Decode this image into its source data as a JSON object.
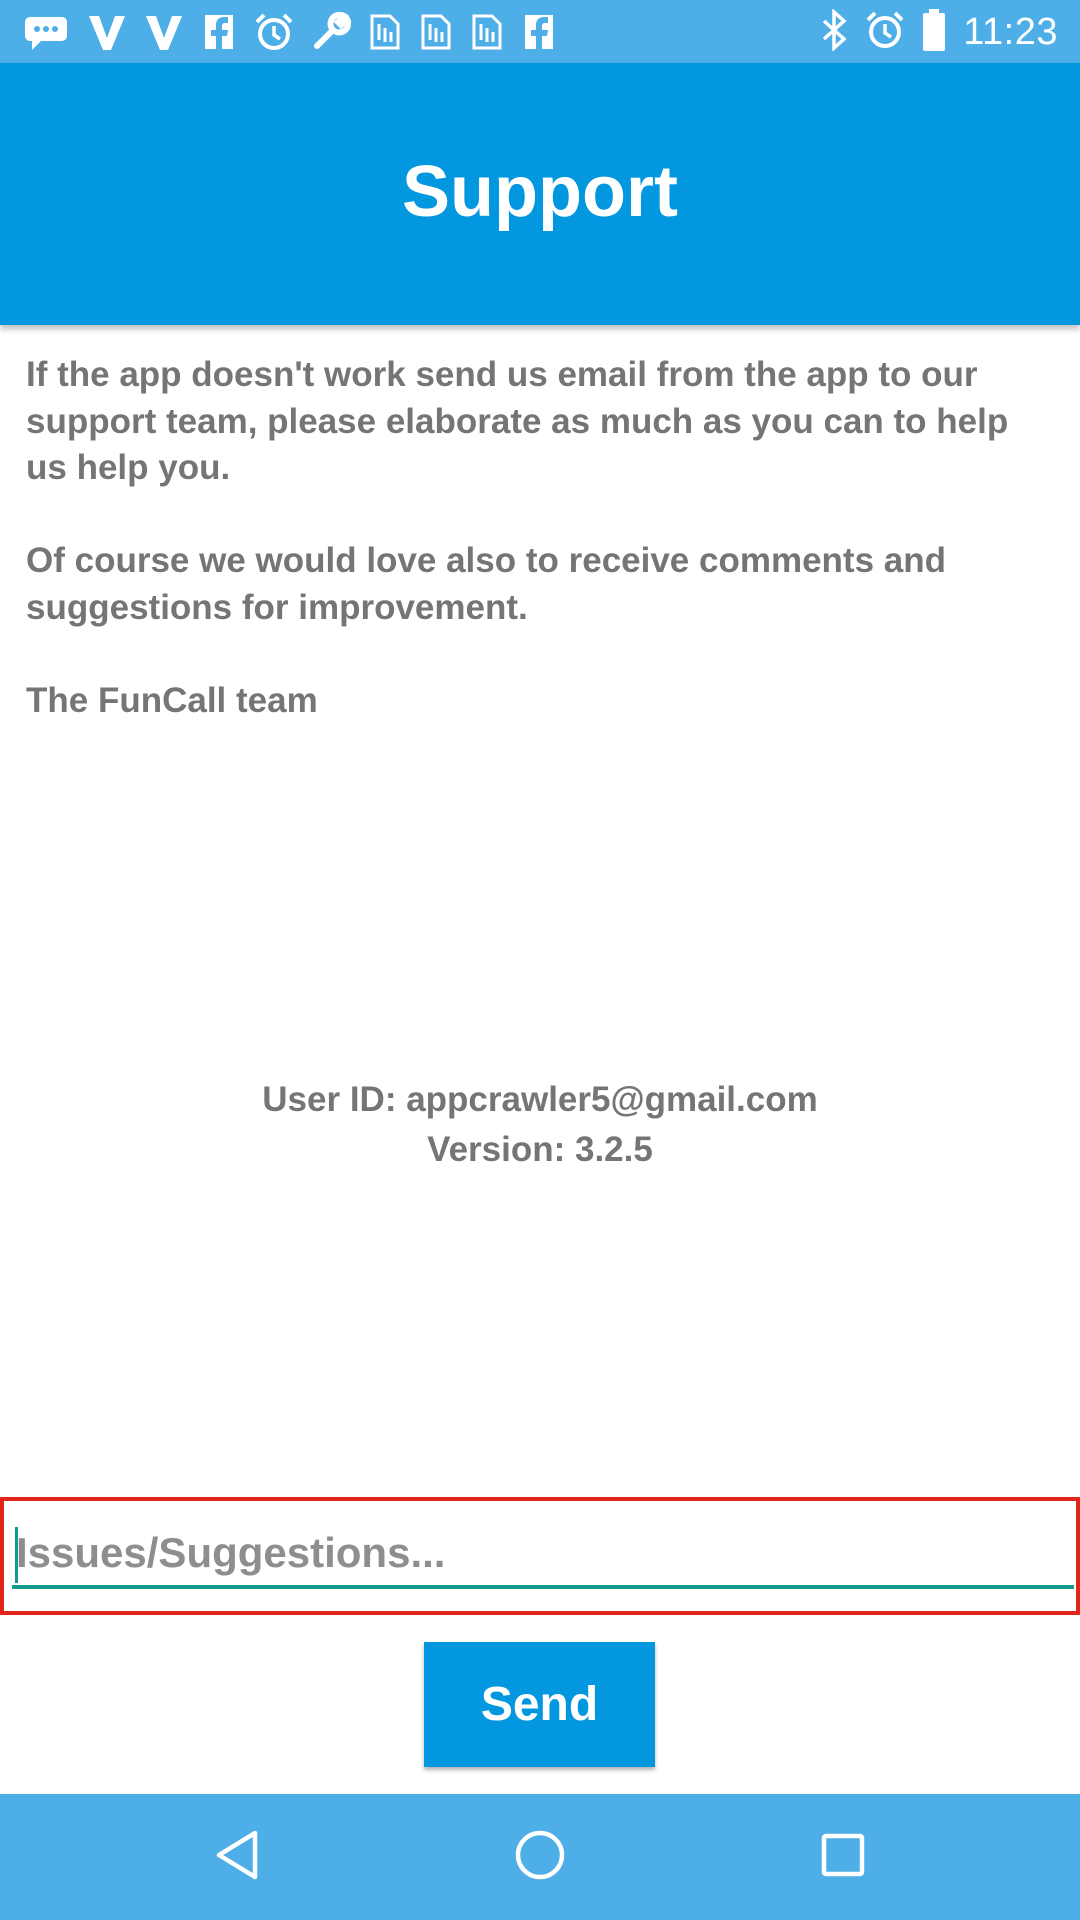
{
  "status_bar": {
    "time": "11:23",
    "left_icons": [
      "chat-icon",
      "vee-icon",
      "vee-icon",
      "facebook-icon",
      "alarm-icon",
      "wrench-icon",
      "sim-icon",
      "sim-icon",
      "sim-icon",
      "facebook-icon"
    ],
    "right_icons": [
      "bluetooth-icon",
      "alarm-icon",
      "battery-icon"
    ]
  },
  "app_bar": {
    "title": "Support"
  },
  "intro": {
    "paragraph1": "If the app doesn't work send us email from the app to our support team, please elaborate as much as you can to help us help you.",
    "paragraph2": "Of course we would love also to receive comments and suggestions for improvement.",
    "signature": "The FunCall team"
  },
  "info": {
    "user_id": "User ID: appcrawler5@gmail.com",
    "version": "Version: 3.2.5"
  },
  "issues_input": {
    "value": "",
    "placeholder": "Issues/Suggestions..."
  },
  "send_button": {
    "label": "Send"
  },
  "nav_bar": {
    "back": "back-icon",
    "home": "home-icon",
    "recents": "recents-icon"
  },
  "colors": {
    "status_bar": "#4eaee8",
    "app_bar": "#0397e0",
    "accent_underline": "#139b8b",
    "highlight_frame": "#e1251b",
    "body_text": "#757575"
  }
}
